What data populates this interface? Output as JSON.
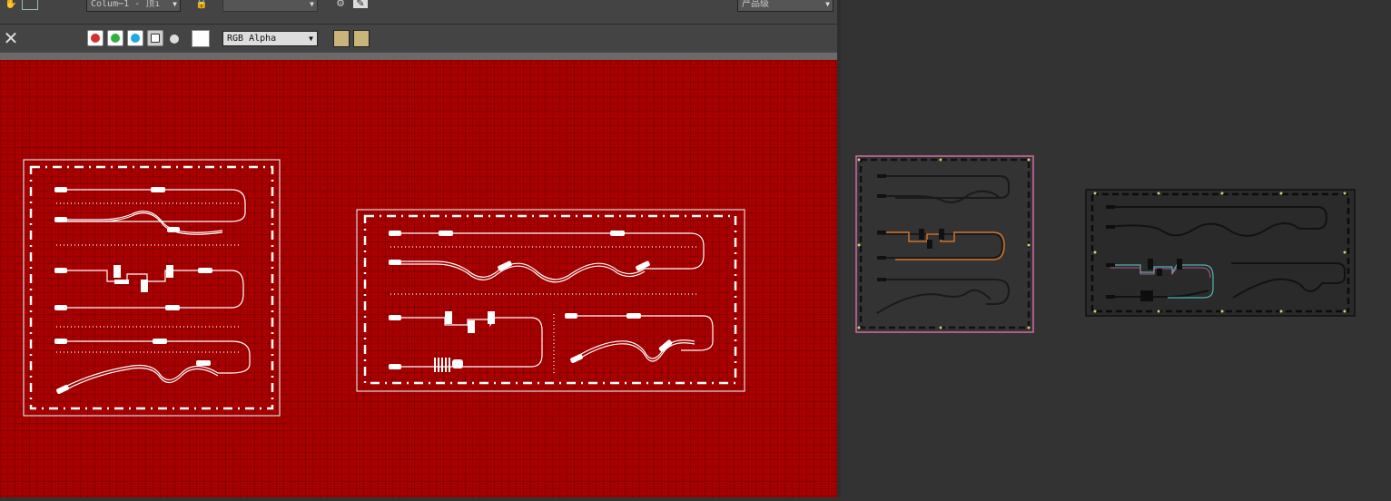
{
  "toolbar": {
    "layer_dropdown": "Colum⋯1 - 顶ı",
    "blank_dropdown": "",
    "quality_dropdown": "产品级"
  },
  "toolbar2": {
    "channel_select": "RGB Alpha"
  },
  "colors": {
    "viewport_bg": "#a80000",
    "panel_bg": "#333333",
    "toolbar_bg": "#444444",
    "selection_outline": "#d46aa8",
    "orange_trace": "#d0732a",
    "cyan_trace": "#4fb3b3"
  },
  "icons": {
    "close": "close-icon",
    "red_channel": "red-channel-icon",
    "green_channel": "green-channel-icon",
    "blue_channel": "blue-channel-icon",
    "alpha_channel": "alpha-channel-icon",
    "mono": "monochrome-icon",
    "swatch": "color-swatch-icon",
    "save_image": "save-image-icon",
    "clone_image": "clone-image-icon",
    "lock": "lock-icon",
    "pan": "pan-hand-icon",
    "render_settings": "render-settings-icon",
    "edit": "edit-icon"
  }
}
